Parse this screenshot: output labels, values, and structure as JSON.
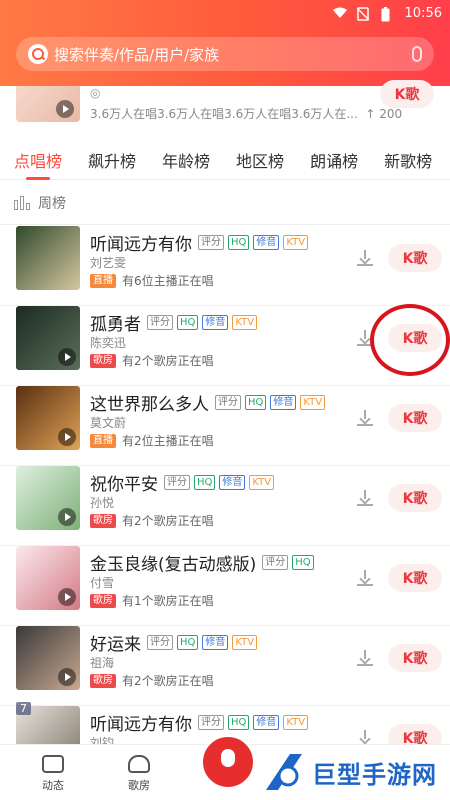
{
  "status_bar": {
    "time": "10:56"
  },
  "search": {
    "placeholder": "搜索伴奏/作品/用户/家族"
  },
  "top_card": {
    "stats": "3.6万人在唱3.6万人在唱3.6万人在唱3.6万人在...",
    "likes": "↑ 200",
    "k_label": "K歌"
  },
  "tabs": [
    {
      "label": "点唱榜",
      "active": true
    },
    {
      "label": "飙升榜"
    },
    {
      "label": "年龄榜"
    },
    {
      "label": "地区榜"
    },
    {
      "label": "朗诵榜"
    },
    {
      "label": "新歌榜"
    }
  ],
  "filter": {
    "label": "周榜"
  },
  "songs": [
    {
      "title": "听闻远方有你",
      "artist": "刘艺雯",
      "tags": [
        "评分",
        "HQ",
        "修音",
        "KTV"
      ],
      "badge": "直播",
      "badge_color": "orange",
      "status": "有6位主播正在唱",
      "k_label": "K歌",
      "cover_colors": [
        "#2f4a2c",
        "#d7c7a1"
      ]
    },
    {
      "title": "孤勇者",
      "artist": "陈奕迅",
      "tags": [
        "评分",
        "HQ",
        "修音",
        "KTV"
      ],
      "badge": "歌房",
      "badge_color": "red",
      "status": "有2个歌房正在唱",
      "k_label": "K歌",
      "cover_colors": [
        "#1b2b22",
        "#5b6e59"
      ]
    },
    {
      "title": "这世界那么多人",
      "artist": "莫文蔚",
      "tags": [
        "评分",
        "HQ",
        "修音",
        "KTV"
      ],
      "badge": "直播",
      "badge_color": "orange",
      "status": "有2位主播正在唱",
      "k_label": "K歌",
      "cover_colors": [
        "#5a2f12",
        "#e0a458"
      ]
    },
    {
      "title": "祝你平安",
      "artist": "孙悦",
      "tags": [
        "评分",
        "HQ",
        "修音",
        "KTV"
      ],
      "badge": "歌房",
      "badge_color": "red",
      "status": "有2个歌房正在唱",
      "k_label": "K歌",
      "cover_colors": [
        "#dff0df",
        "#7fb07a"
      ]
    },
    {
      "title": "金玉良缘(复古动感版)",
      "artist": "付雪",
      "tags": [
        "评分",
        "HQ"
      ],
      "badge": "歌房",
      "badge_color": "red",
      "status": "有1个歌房正在唱",
      "k_label": "K歌",
      "cover_colors": [
        "#fbe9ec",
        "#d47a86"
      ]
    },
    {
      "title": "好运来",
      "artist": "祖海",
      "tags": [
        "评分",
        "HQ",
        "修音",
        "KTV"
      ],
      "badge": "歌房",
      "badge_color": "red",
      "status": "有2个歌房正在唱",
      "k_label": "K歌",
      "cover_colors": [
        "#3a3a3a",
        "#c9a892"
      ]
    },
    {
      "title": "听闻远方有你",
      "artist": "刘钧",
      "tags": [
        "评分",
        "HQ",
        "修音",
        "KTV"
      ],
      "rank": "7",
      "k_label": "K歌",
      "cover_colors": [
        "#e6e2dc",
        "#7e7466"
      ]
    }
  ],
  "bottom_nav": {
    "feed_label": "动态",
    "room_label": "歌房"
  },
  "watermark": {
    "text": "巨型手游网"
  }
}
